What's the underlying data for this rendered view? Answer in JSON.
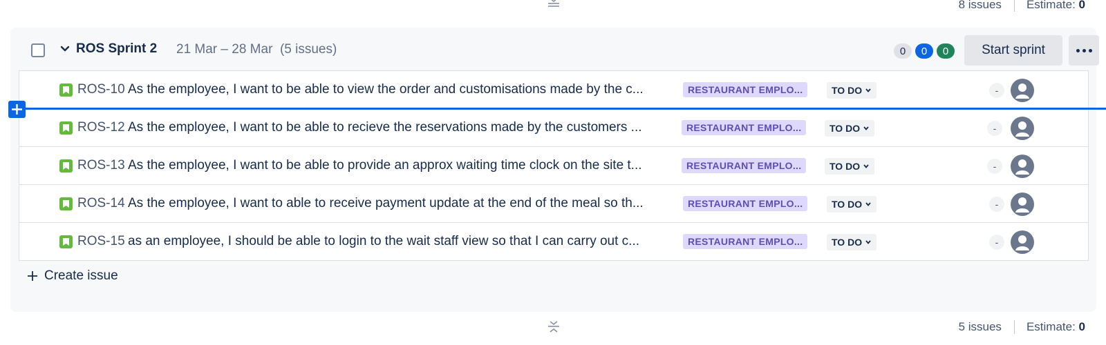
{
  "top_footer": {
    "issue_count": "8 issues",
    "estimate_label": "Estimate:",
    "estimate_value": "0"
  },
  "sprint": {
    "name": "ROS Sprint 2",
    "dates": "21 Mar – 28 Mar",
    "issue_count": "(5 issues)",
    "counts": {
      "todo": "0",
      "in_progress": "0",
      "done": "0"
    },
    "start_button": "Start sprint",
    "more_button_icon": "more-horizontal-icon",
    "issues": [
      {
        "key": "ROS-10",
        "summary": "As the employee, I want to be able to view the order and customisations made by the c...",
        "epic": "RESTAURANT EMPLO...",
        "status": "TO DO",
        "estimate": "-"
      },
      {
        "key": "ROS-12",
        "summary": "As the employee, I want to be able to recieve the reservations made by the customers ...",
        "epic": "RESTAURANT EMPLO...",
        "status": "TO DO",
        "estimate": "-"
      },
      {
        "key": "ROS-13",
        "summary": "As the employee, I want to be able to provide an approx waiting time clock on the site t...",
        "epic": "RESTAURANT EMPLO...",
        "status": "TO DO",
        "estimate": "-"
      },
      {
        "key": "ROS-14",
        "summary": "As the employee, I want to able to receive payment update at the end of the meal so th...",
        "epic": "RESTAURANT EMPLO...",
        "status": "TO DO",
        "estimate": "-"
      },
      {
        "key": "ROS-15",
        "summary": "as an employee, I should be able to login to the wait staff view so that I can carry out c...",
        "epic": "RESTAURANT EMPLO...",
        "status": "TO DO",
        "estimate": "-"
      }
    ],
    "create_issue_label": "Create issue"
  },
  "bottom_footer": {
    "issue_count": "5 issues",
    "estimate_label": "Estimate:",
    "estimate_value": "0"
  },
  "colors": {
    "accent_blue": "#0c66e4",
    "story_green": "#63ba3c",
    "epic_purple": "#dfd8fd",
    "done_green": "#1f845a"
  }
}
